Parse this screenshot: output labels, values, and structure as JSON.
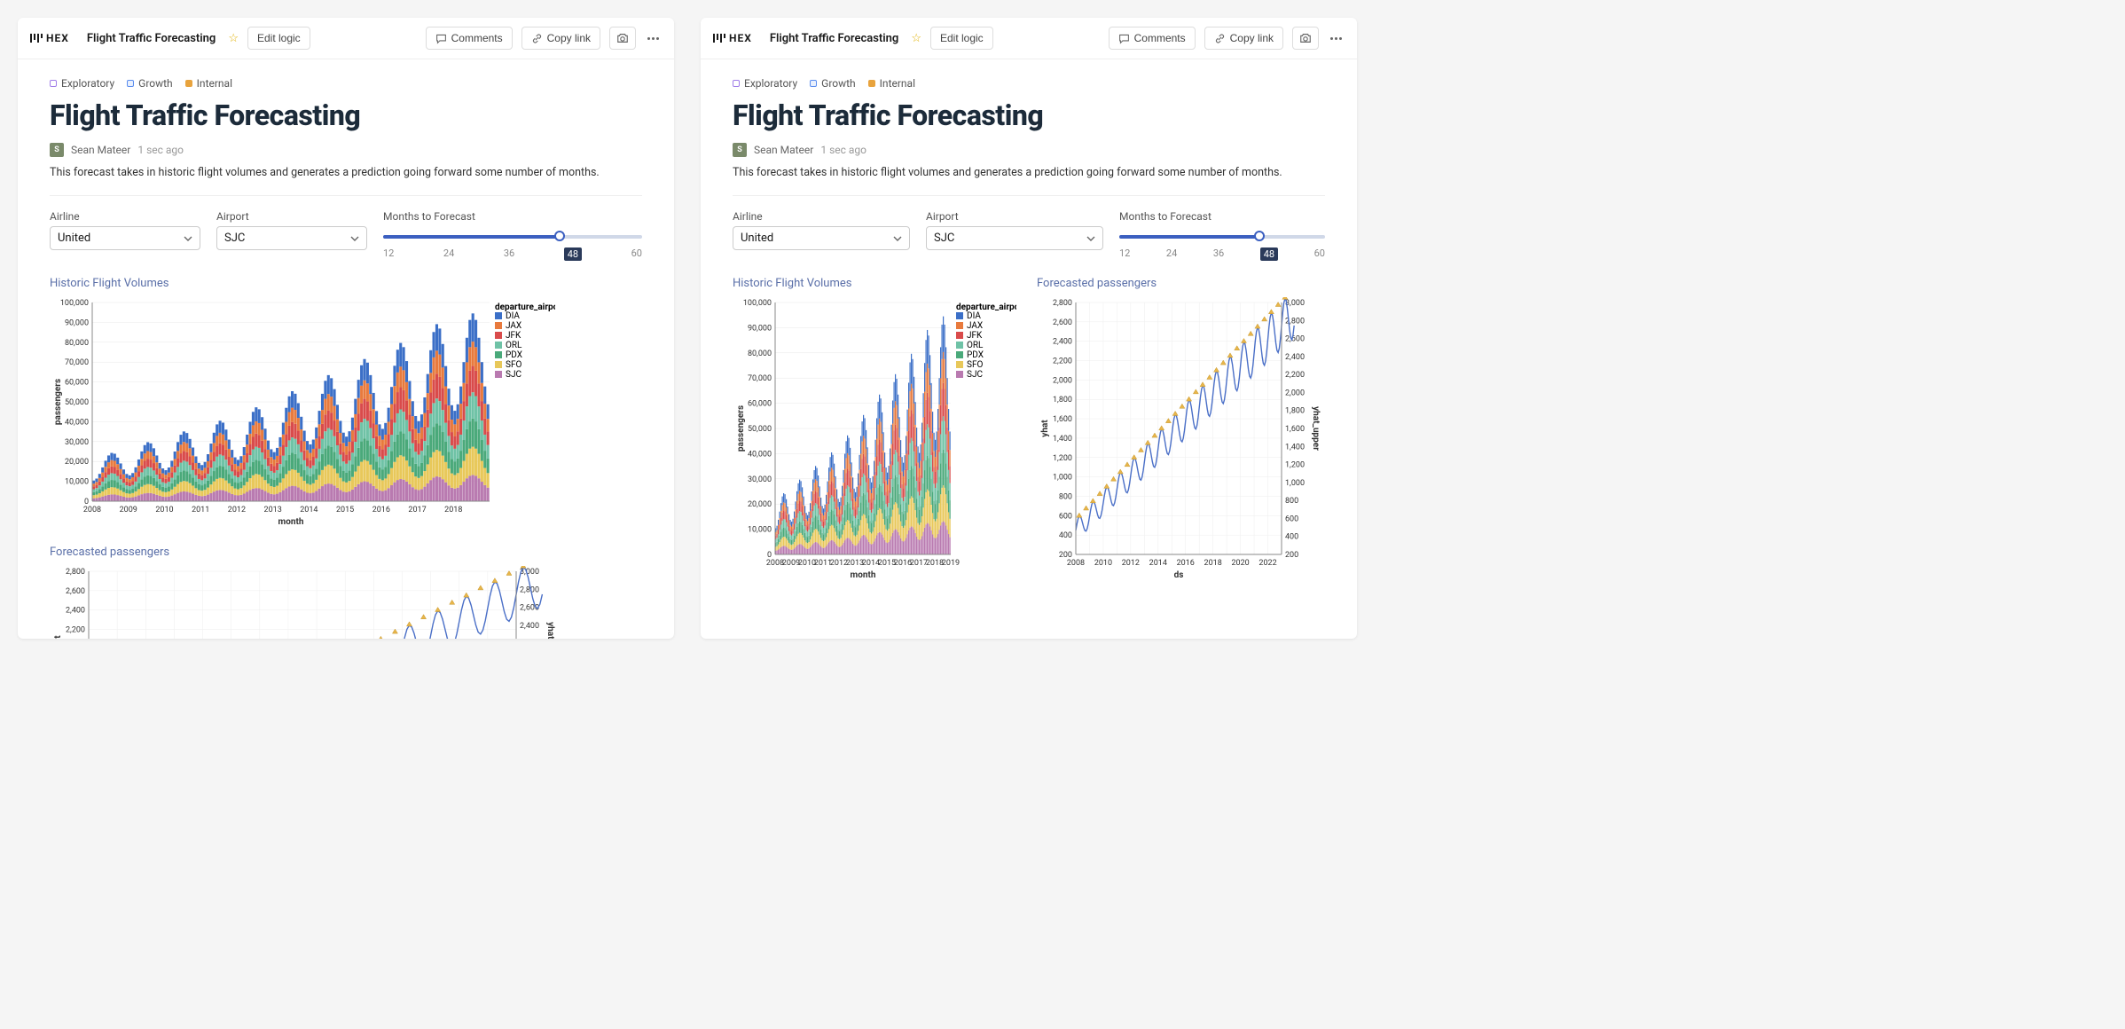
{
  "logo_text": "HEX",
  "project_title": "Flight Traffic Forecasting",
  "edit_logic": "Edit logic",
  "comments": "Comments",
  "copy_link": "Copy link",
  "tags": [
    {
      "label": "Exploratory",
      "color": "purple"
    },
    {
      "label": "Growth",
      "color": "blue"
    },
    {
      "label": "Internal",
      "color": "orange"
    }
  ],
  "page_title": "Flight Traffic Forecasting",
  "author_initial": "S",
  "author_name": "Sean Mateer",
  "timestamp": "1 sec ago",
  "description": "This forecast takes in historic flight volumes and generates a prediction going forward some number of months.",
  "controls": {
    "airline_label": "Airline",
    "airline_value": "United",
    "airport_label": "Airport",
    "airport_value": "SJC",
    "slider_label": "Months to Forecast",
    "slider_ticks": [
      "12",
      "24",
      "36",
      "48",
      "60"
    ],
    "slider_value": "48"
  },
  "chart1_title": "Historic Flight Volumes",
  "chart2_title": "Forecasted passengers",
  "chart_data": [
    {
      "id": "historic_large",
      "type": "bar",
      "title": "Historic Flight Volumes",
      "xlabel": "month",
      "ylabel": "passengers",
      "ylim": [
        0,
        100000
      ],
      "yticks": [
        0,
        10000,
        20000,
        30000,
        40000,
        50000,
        60000,
        70000,
        80000,
        90000,
        100000
      ],
      "categories": [
        "2008",
        "2009",
        "2010",
        "2011",
        "2012",
        "2013",
        "2014",
        "2015",
        "2016",
        "2017",
        "2018"
      ],
      "legend_title": "departure_airport",
      "series": [
        {
          "name": "DIA",
          "color": "#3b6fc7"
        },
        {
          "name": "JAX",
          "color": "#e87a3d"
        },
        {
          "name": "JFK",
          "color": "#d94b4b"
        },
        {
          "name": "ORL",
          "color": "#6fc2a6"
        },
        {
          "name": "PDX",
          "color": "#4aa97a"
        },
        {
          "name": "SFO",
          "color": "#e8c85a"
        },
        {
          "name": "SJC",
          "color": "#b97ab0"
        }
      ],
      "base_per_year": [
        16000,
        20000,
        24000,
        28000,
        32000,
        38000,
        44000,
        50000,
        56000,
        62000,
        70000
      ],
      "seasonal_amp": 0.35,
      "months_per_year": 12
    },
    {
      "id": "forecast",
      "type": "line",
      "title": "Forecasted passengers",
      "xlabel": "ds",
      "ylabel": "yhat",
      "y2label": "yhat_upper",
      "xlim": [
        2008,
        2023
      ],
      "ylim": [
        200,
        2800
      ],
      "y2lim": [
        200,
        3000
      ],
      "yticks": [
        200,
        400,
        600,
        800,
        1000,
        1200,
        1400,
        1600,
        1800,
        2000,
        2200,
        2400,
        2600,
        2800
      ],
      "y2ticks": [
        200,
        400,
        600,
        800,
        1000,
        1200,
        1400,
        1600,
        1800,
        2000,
        2200,
        2400,
        2600,
        2800,
        3000
      ],
      "xticks": [
        2008,
        2010,
        2012,
        2014,
        2016,
        2018,
        2020,
        2022
      ],
      "trend_start": 450,
      "trend_end": 2700,
      "seasonal_amp": 180,
      "months": 192
    }
  ]
}
